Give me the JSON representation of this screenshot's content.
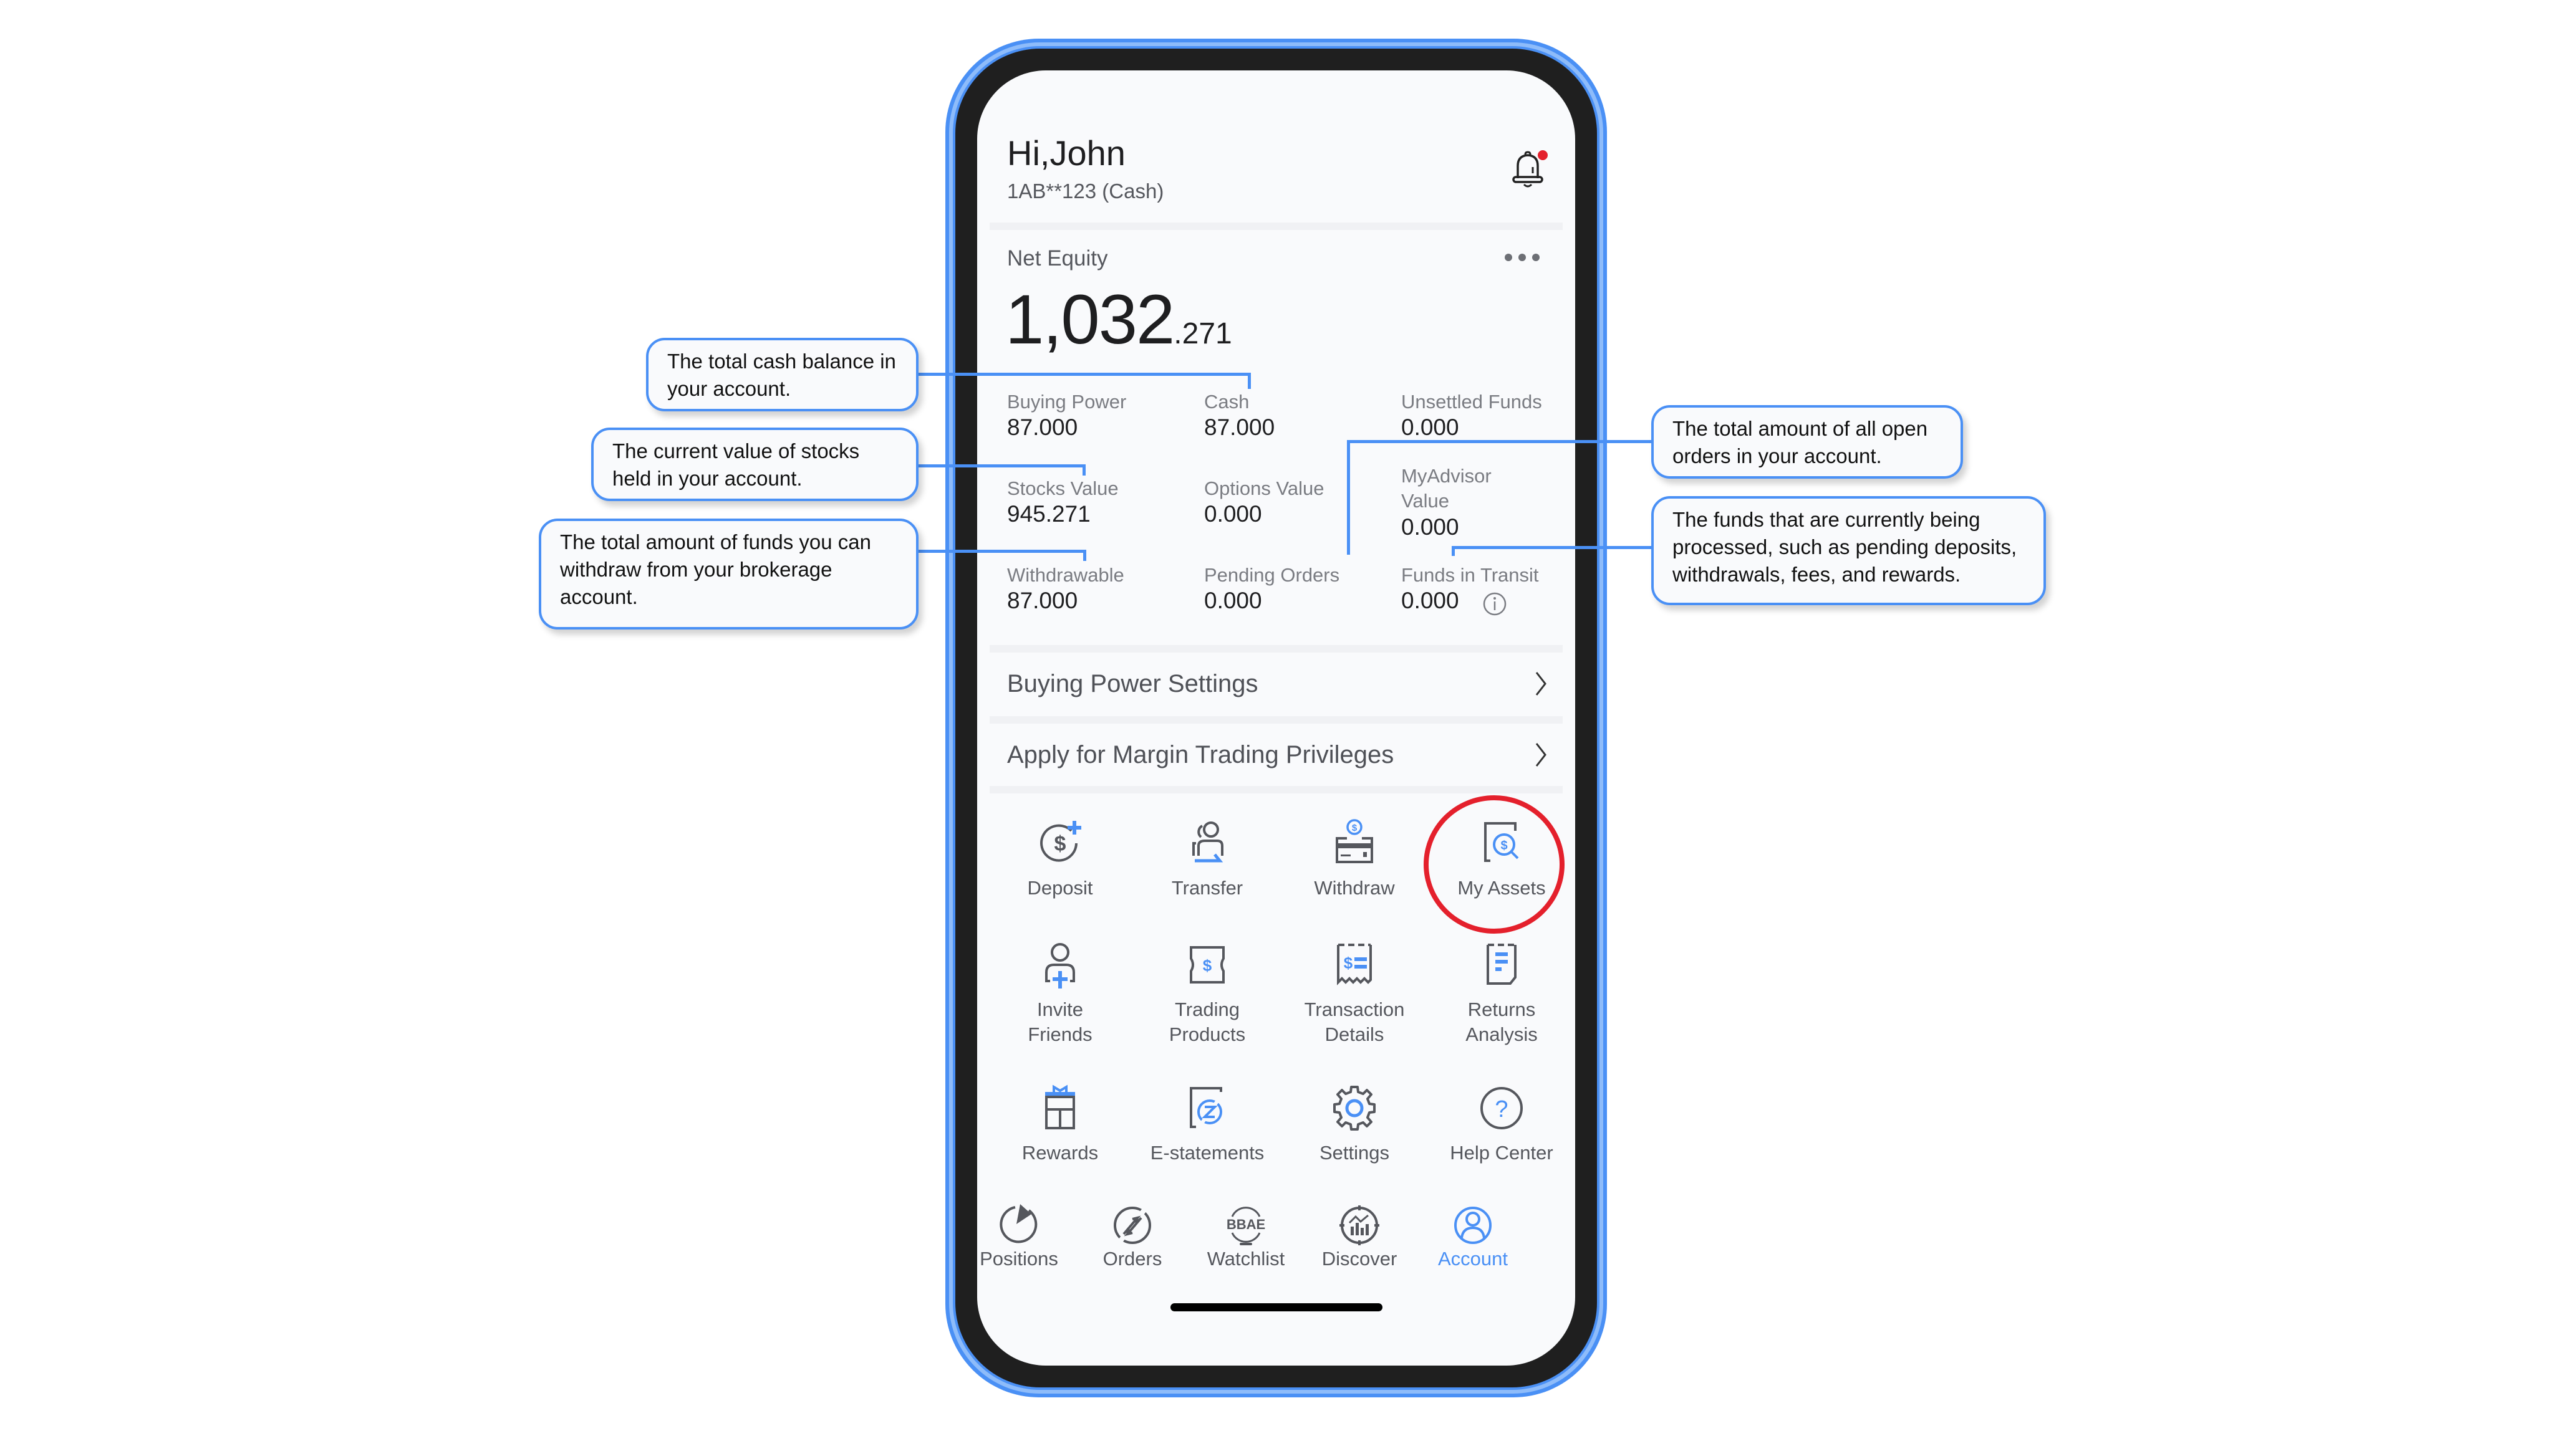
{
  "header": {
    "greeting": "Hi,John",
    "account_label": "1AB**123 (Cash)",
    "notification_badge_color": "#e4202c"
  },
  "net_equity": {
    "label": "Net Equity",
    "value_integer": "1,032",
    "value_decimal": ".271"
  },
  "stats": [
    {
      "label": "Buying Power",
      "value": "87.000"
    },
    {
      "label": "Cash",
      "value": "87.000"
    },
    {
      "label": "Unsettled Funds",
      "value": "0.000"
    },
    {
      "label": "Stocks Value",
      "value": "945.271"
    },
    {
      "label": "Options Value",
      "value": "0.000"
    },
    {
      "label": "MyAdvisor Value",
      "label_line1": "MyAdvisor",
      "label_line2": "Value",
      "value": "0.000"
    },
    {
      "label": "Withdrawable",
      "value": "87.000"
    },
    {
      "label": "Pending Orders",
      "value": "0.000"
    },
    {
      "label": "Funds in Transit",
      "value": "0.000"
    }
  ],
  "menu_rows": [
    {
      "label": "Buying Power Settings"
    },
    {
      "label": "Apply for Margin Trading Privileges"
    }
  ],
  "grid": [
    {
      "label": "Deposit",
      "icon": "deposit-icon"
    },
    {
      "label": "Transfer",
      "icon": "transfer-icon"
    },
    {
      "label": "Withdraw",
      "icon": "withdraw-icon"
    },
    {
      "label": "My Assets",
      "icon": "my-assets-icon",
      "highlighted": true
    },
    {
      "label_line1": "Invite",
      "label_line2": "Friends",
      "icon": "invite-friends-icon"
    },
    {
      "label_line1": "Trading",
      "label_line2": "Products",
      "icon": "trading-products-icon"
    },
    {
      "label_line1": "Transaction",
      "label_line2": "Details",
      "icon": "transaction-details-icon"
    },
    {
      "label_line1": "Returns",
      "label_line2": "Analysis",
      "icon": "returns-analysis-icon"
    },
    {
      "label": "Rewards",
      "icon": "rewards-icon"
    },
    {
      "label": "E-statements",
      "icon": "e-statements-icon"
    },
    {
      "label": "Settings",
      "icon": "settings-icon"
    },
    {
      "label": "Help Center",
      "icon": "help-center-icon"
    }
  ],
  "tabs": [
    {
      "label": "Positions",
      "icon": "positions-icon"
    },
    {
      "label": "Orders",
      "icon": "orders-icon"
    },
    {
      "label": "Watchlist",
      "icon": "watchlist-icon",
      "logo_text": "BBAE"
    },
    {
      "label": "Discover",
      "icon": "discover-icon"
    },
    {
      "label": "Account",
      "icon": "account-icon",
      "active": true
    }
  ],
  "callouts": {
    "cash": "The total cash balance in your account.",
    "stocks": "The current value of stocks held in your account.",
    "withdrawable": "The total amount of funds you can withdraw from your brokerage account.",
    "pending_orders": "The total amount of all open orders in your account.",
    "funds_in_transit": "The funds that are currently being processed, such as pending deposits, withdrawals, fees, and rewards."
  },
  "colors": {
    "accent": "#4a90f5",
    "highlight": "#e4202c",
    "icon_dark": "#55575d"
  }
}
